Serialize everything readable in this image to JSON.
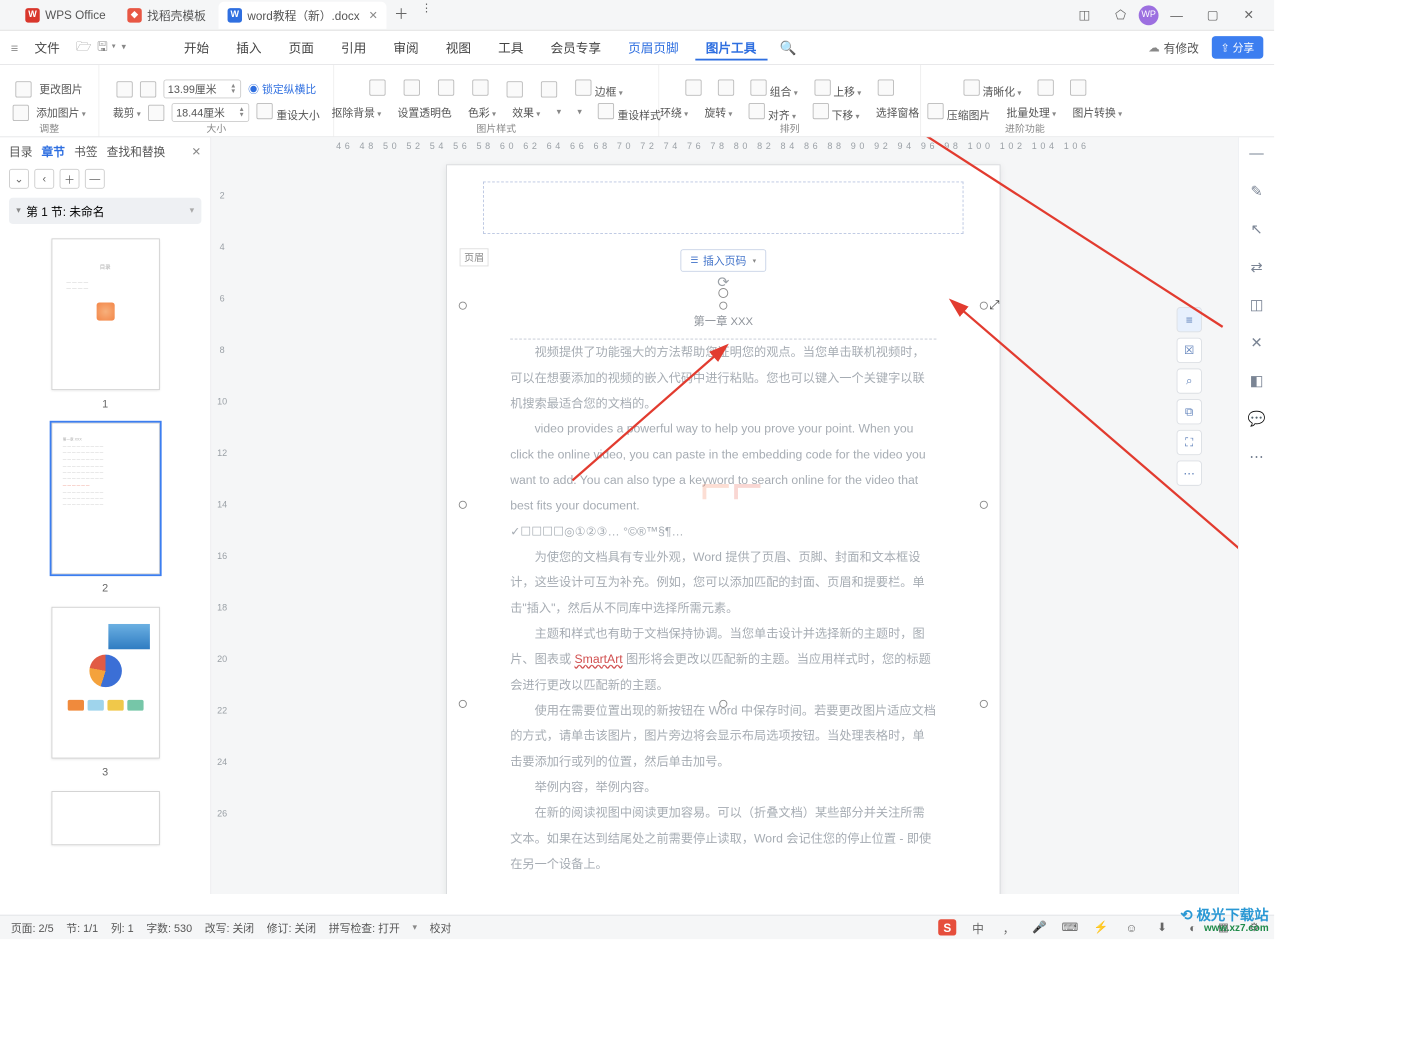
{
  "titlebar": {
    "tabs": [
      {
        "icon_bg": "#d9372c",
        "icon_text": "W",
        "label": "WPS Office"
      },
      {
        "icon_bg": "#e85744",
        "icon_text": "",
        "label": "找稻壳模板"
      },
      {
        "icon_bg": "#2f6fe0",
        "icon_text": "W",
        "label": "word教程（新）.docx",
        "active": true,
        "has_close": true
      }
    ],
    "avatar": "WP"
  },
  "menubar": {
    "file": "文件",
    "items": [
      "开始",
      "插入",
      "页面",
      "引用",
      "审阅",
      "视图",
      "工具",
      "会员专享"
    ],
    "header_footer": "页眉页脚",
    "image_tools": "图片工具",
    "has_edit": "有修改",
    "share": "分享"
  },
  "ribbon": {
    "adjust": {
      "change_pic": "更改图片",
      "add_pic": "添加图片",
      "foot": "调整"
    },
    "size": {
      "width": "13.99厘米",
      "height": "18.44厘米",
      "crop": "裁剪",
      "lock": "锁定纵横比",
      "reset": "重设大小",
      "foot": "大小"
    },
    "style": {
      "remove_bg": "抠除背景",
      "trans": "设置透明色",
      "color": "色彩",
      "effect": "效果",
      "border": "边框",
      "reset": "重设样式",
      "foot": "图片样式"
    },
    "arrange": {
      "wrap": "环绕",
      "rotate": "旋转",
      "group": "组合",
      "align": "对齐",
      "up": "上移",
      "down": "下移",
      "pane": "选择窗格",
      "foot": "排列"
    },
    "advanced": {
      "clarity": "清晰化",
      "compress": "压缩图片",
      "batch": "批量处理",
      "convert": "图片转换",
      "foot": "进阶功能"
    }
  },
  "leftpane": {
    "tabs": {
      "toc": "目录",
      "chapter": "章节",
      "bookmark": "书签",
      "find": "查找和替换"
    },
    "section": "第 1 节: 未命名",
    "thumbs": [
      1,
      2,
      3
    ]
  },
  "ruler_h": "46   48   50   52   54   56   58   60   62   64   66   68   70   72   74   76   78   80   82   84   86   88   90   92   94   96   98   100   102   104   106",
  "ruler_v": [
    2,
    4,
    6,
    8,
    10,
    12,
    14,
    16,
    18,
    20,
    22,
    24,
    26
  ],
  "page": {
    "header_label": "页眉",
    "insert_pg": "插入页码",
    "first": "第一章   XXX",
    "p1": "视频提供了功能强大的方法帮助您证明您的观点。当您单击联机视频时，可以在想要添加的视频的嵌入代码中进行粘贴。您也可以键入一个关键字以联机搜索最适合您的文档的。",
    "p2": "video provides a powerful way to help you prove your point. When you click the online video, you can paste in the embedding code for the video you want to add. You can also type a keyword to search online for the video that best fits your document.",
    "symbols": "✓☐☐☐☐◎①②③…            °©®™§¶…",
    "p3": "为使您的文档具有专业外观，Word 提供了页眉、页脚、封面和文本框设计，这些设计可互为补充。例如，您可以添加匹配的封面、页眉和提要栏。单击\"插入\"，然后从不同库中选择所需元素。",
    "p4_a": "主题和样式也有助于文档保持协调。当您单击设计并选择新的主题时，图片、图表或 ",
    "smartart": "SmartArt",
    "p4_b": " 图形将会更改以匹配新的主题。当应用样式时，您的标题会进行更改以匹配新的主题。",
    "p5": "使用在需要位置出现的新按钮在 Word 中保存时间。若要更改图片适应文档的方式，请单击该图片，图片旁边将会显示布局选项按钮。当处理表格时，单击要添加行或列的位置，然后单击加号。",
    "p6": "举例内容，举例内容。",
    "p7": "在新的阅读视图中阅读更加容易。可以（折叠文档）某些部分并关注所需文本。如果在达到结尾处之前需要停止读取，Word 会记住您的停止位置 - 即使在另一个设备上。"
  },
  "sidefloat": [
    "≡",
    "☒",
    "⌕",
    "⧉",
    "⛶",
    "⋯"
  ],
  "rightstrip": [
    "—",
    "✎",
    "↖",
    "⇄",
    "◫",
    "✕",
    "◧",
    "💬",
    "⋯"
  ],
  "status": {
    "page": "页面: 2/5",
    "sec": "节: 1/1",
    "col": "列: 1",
    "words": "字数: 530",
    "track": "改写: 关闭",
    "rev": "修订: 关闭",
    "spell": "拼写检查: 打开",
    "proof": "校对"
  },
  "colors": {
    "blue": "#2f6fe0",
    "red_arrow": "#e23b2f"
  },
  "watermark": {
    "brand": "极光下载站",
    "url": "www.xz7.com"
  }
}
